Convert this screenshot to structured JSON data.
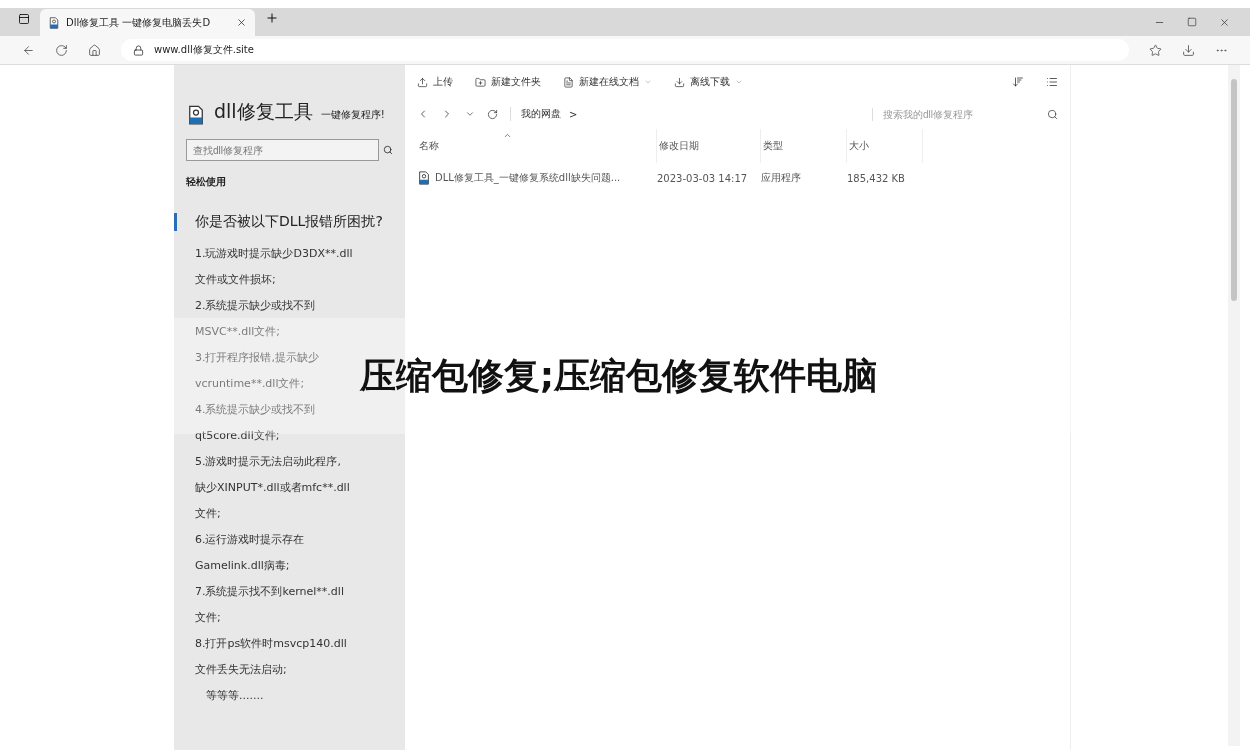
{
  "browser": {
    "tab_title": "Dll修复工具 一键修复电脑丢失D",
    "url": "www.dll修复文件.site"
  },
  "sidebar": {
    "logo": "dll修复工具",
    "tagline": "一键修复程序!",
    "search_placeholder": "查找dll修复程序",
    "section": "轻松使用",
    "heading": "你是否被以下DLL报错所困扰?",
    "lines": [
      "1.玩游戏时提示缺少D3DX**.dll",
      "文件或文件损坏;",
      "2.系统提示缺少或找不到",
      "MSVC**.dll文件;",
      "3.打开程序报错,提示缺少",
      "vcruntime**.dll文件;",
      "4.系统提示缺少或找不到",
      "qt5core.dll文件;",
      "5.游戏时提示无法启动此程序,",
      "缺少XINPUT*.dll或者mfc**.dll",
      "文件;",
      "6.运行游戏时提示存在",
      "Gamelink.dll病毒;",
      "7.系统提示找不到kernel**.dll",
      "文件;",
      "8.打开ps软件时msvcp140.dll",
      "文件丢失无法启动;",
      "等等等......."
    ]
  },
  "toolbar": [
    {
      "kind": "upload",
      "label": "上传",
      "dropdown": false
    },
    {
      "kind": "folder",
      "label": "新建文件夹",
      "dropdown": false
    },
    {
      "kind": "doc",
      "label": "新建在线文档",
      "dropdown": true
    },
    {
      "kind": "download",
      "label": "离线下载",
      "dropdown": true
    }
  ],
  "breadcrumb": "我的网盘",
  "breadcrumb_separator": ">",
  "search_placeholder": "搜索我的dll修复程序",
  "table": {
    "columns": [
      "名称",
      "修改日期",
      "类型",
      "大小"
    ],
    "rows": [
      {
        "name": "DLL修复工具_一键修复系统dll缺失问题...",
        "date": "2023-03-03 14:17",
        "type": "应用程序",
        "size": "185,432 KB"
      }
    ]
  },
  "overlay_title": "压缩包修复;压缩包修复软件电脑"
}
